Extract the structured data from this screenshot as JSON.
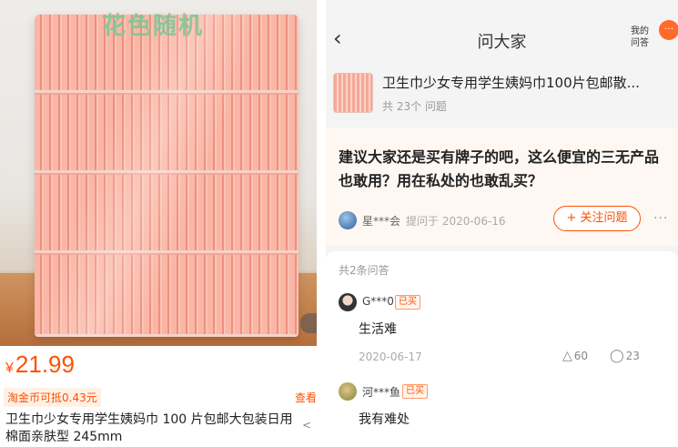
{
  "left": {
    "watermark": "花色随机",
    "currency": "¥",
    "price": "21.99",
    "coin_tag": "淘金币可抵0.43元",
    "view_link": "查看",
    "title": "卫生巾少女专用学生姨妈巾 100 片包邮大包装日用棉面亲肤型 245mm",
    "share_icon": "share-icon"
  },
  "right": {
    "back_icon": "back-arrow-icon",
    "page_title": "问大家",
    "my_questions": "我的问答",
    "menu_icon": "more-menu-icon",
    "product": {
      "name": "卫生巾少女专用学生姨妈巾100片包邮散...",
      "count": "共 23个 问题"
    },
    "question": {
      "text": "建议大家还是买有牌子的吧，这么便宜的三无产品也敢用？用在私处的也敢乱买？",
      "asker": "星***会",
      "asked_on": "提问于 2020-06-16",
      "follow_label": "+ 关注问题",
      "more": "···"
    },
    "answers_count": "共2条问答",
    "answers": [
      {
        "name": "G***0",
        "badge": "已买",
        "text": "生活难",
        "date": "2020-06-17",
        "likes": "60",
        "comments": "23"
      },
      {
        "name": "河***鱼",
        "badge": "已买",
        "text": "我有难处"
      }
    ]
  },
  "colors": {
    "accent": "#ff5000",
    "follow_border": "#ff5000",
    "card_bg": "#fff7f2"
  }
}
